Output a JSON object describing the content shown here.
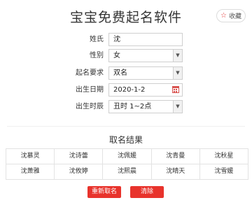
{
  "header": {
    "title": "宝宝免费起名软件",
    "favorite_label": "收藏",
    "favorite_icon": "star-icon",
    "favorite_color": "#e02a2a"
  },
  "form": {
    "surname": {
      "label": "姓氏",
      "value": "沈"
    },
    "gender": {
      "label": "性别",
      "value": "女"
    },
    "naming_requirement": {
      "label": "起名要求",
      "value": "双名"
    },
    "birth_date": {
      "label": "出生日期",
      "value": "2020-1-2"
    },
    "birth_hour": {
      "label": "出生时辰",
      "value": "丑时 1~2点"
    }
  },
  "results": {
    "title": "取名结果",
    "names": [
      "沈慕灵",
      "沈诗蕾",
      "沈佩媛",
      "沈青曼",
      "沈秋星",
      "沈萧雅",
      "沈攸婷",
      "沈熙晨",
      "沈晴天",
      "沈雪媛"
    ]
  },
  "actions": {
    "regenerate_label": "重新取名",
    "clear_label": "清除",
    "accent_color": "#e8332c"
  }
}
